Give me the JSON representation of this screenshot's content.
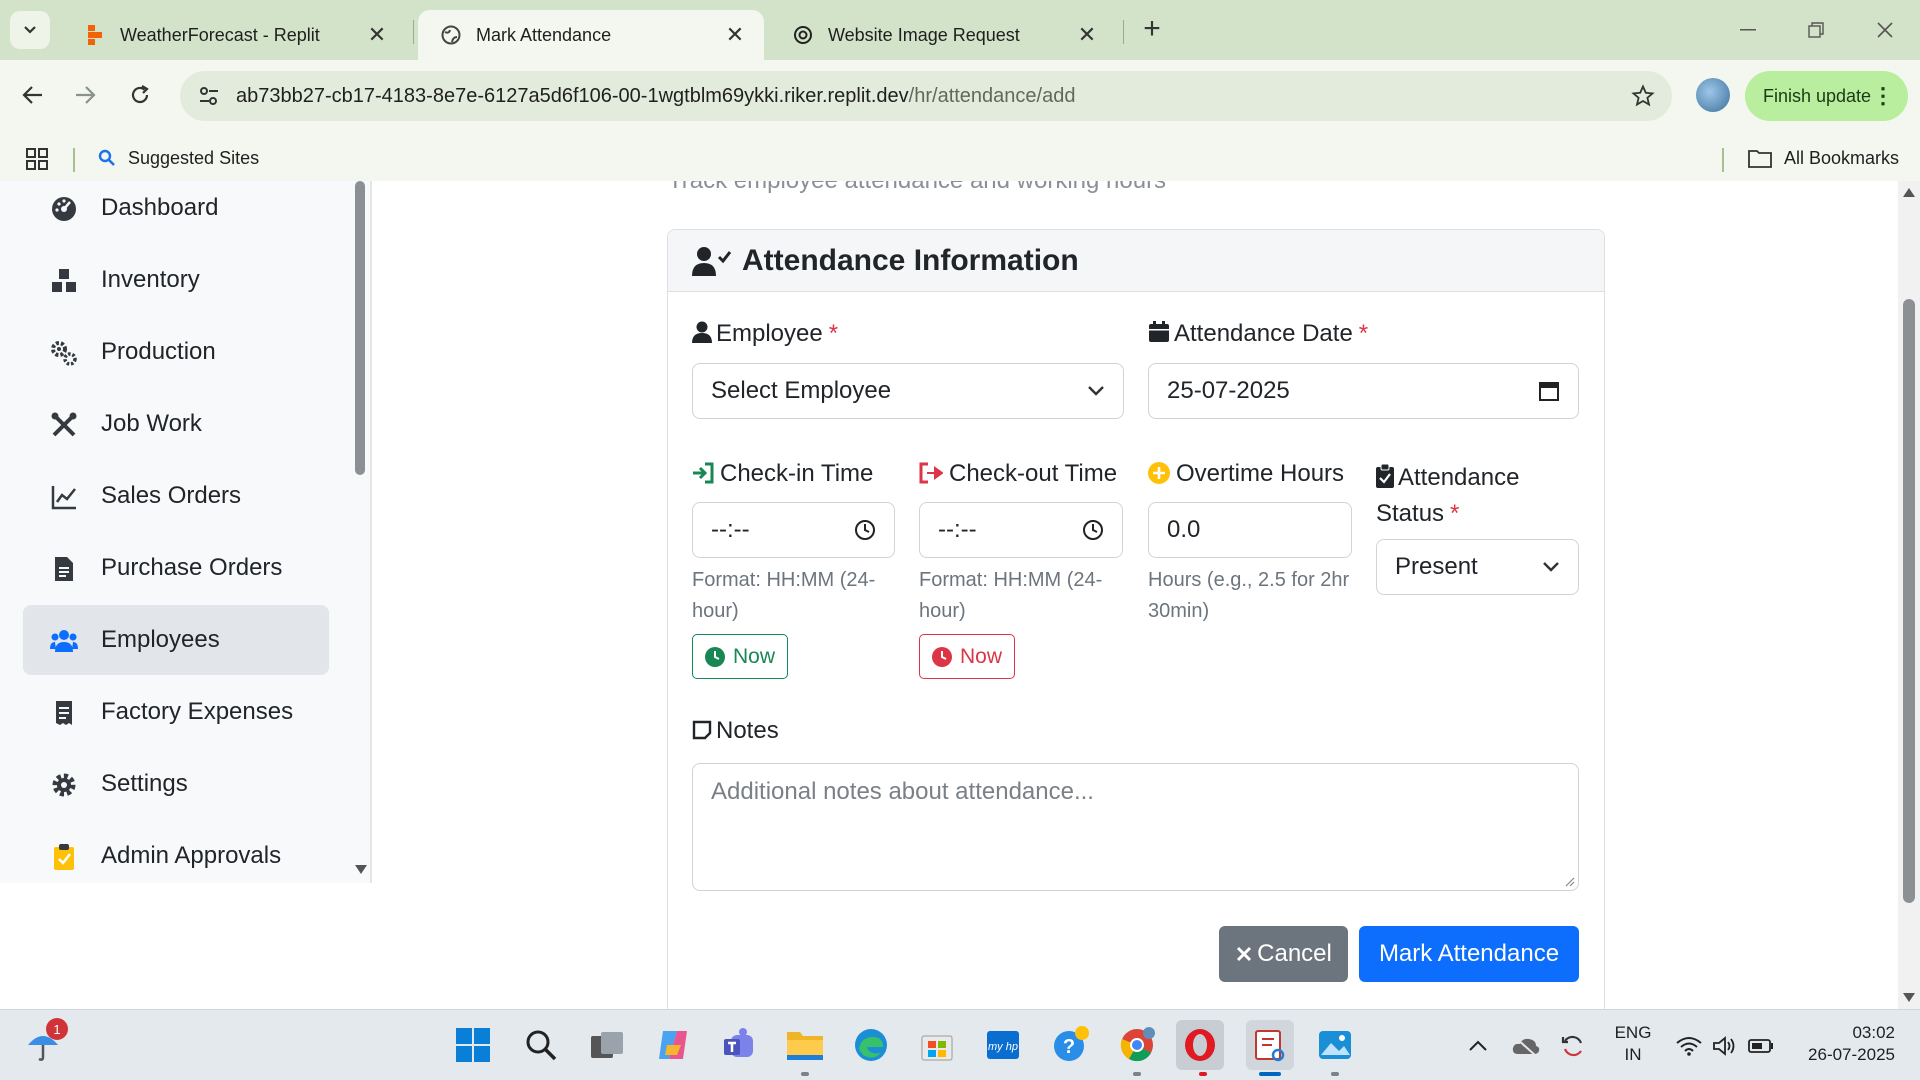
{
  "browser": {
    "tabs": [
      {
        "title": "WeatherForecast - Replit",
        "icon": "replit-icon"
      },
      {
        "title": "Mark Attendance",
        "icon": "globe-icon",
        "active": true
      },
      {
        "title": "Website Image Request",
        "icon": "openai-icon"
      }
    ],
    "url_host": "ab73bb27-cb17-4183-8e7e-6127a5d6f106-00-1wgtblm69ykki.riker.replit.dev",
    "url_path": "/hr/attendance/add",
    "finish_update": "Finish update",
    "bookmarks": {
      "suggested": "Suggested Sites",
      "all": "All Bookmarks"
    }
  },
  "sidebar": {
    "items": [
      {
        "label": "Dashboard",
        "icon": "dashboard-gauge-icon"
      },
      {
        "label": "Inventory",
        "icon": "boxes-icon"
      },
      {
        "label": "Production",
        "icon": "gears-icon"
      },
      {
        "label": "Job Work",
        "icon": "tools-icon"
      },
      {
        "label": "Sales Orders",
        "icon": "line-chart-icon"
      },
      {
        "label": "Purchase Orders",
        "icon": "document-icon"
      },
      {
        "label": "Employees",
        "icon": "users-icon",
        "active": true
      },
      {
        "label": "Factory Expenses",
        "icon": "receipt-icon"
      },
      {
        "label": "Settings",
        "icon": "gear-icon"
      },
      {
        "label": "Admin Approvals",
        "icon": "clipboard-check-icon"
      }
    ]
  },
  "page": {
    "subtitle": "Track employee attendance and working hours"
  },
  "form": {
    "header": "Attendance Information",
    "employee": {
      "label": "Employee",
      "required": "*",
      "value": "Select Employee"
    },
    "date": {
      "label": "Attendance Date",
      "required": "*",
      "value": "25-07-2025"
    },
    "checkin": {
      "label": "Check-in Time",
      "value": "--:--",
      "hint": "Format: HH:MM (24-hour)",
      "now": "Now"
    },
    "checkout": {
      "label": "Check-out Time",
      "value": "--:--",
      "hint": "Format: HH:MM (24-hour)",
      "now": "Now"
    },
    "overtime": {
      "label": "Overtime Hours",
      "value": "0.0",
      "hint": "Hours (e.g., 2.5 for 2hr 30min)"
    },
    "status": {
      "label": "Attendance Status",
      "required": "*",
      "value": "Present"
    },
    "notes": {
      "label": "Notes",
      "placeholder": "Additional notes about attendance..."
    },
    "cancel": "Cancel",
    "submit": "Mark Attendance"
  },
  "taskbar": {
    "notification_count": "1",
    "lang_line1": "ENG",
    "lang_line2": "IN",
    "time": "03:02",
    "date": "26-07-2025"
  },
  "colors": {
    "primary": "#0d6efd",
    "success": "#198754",
    "danger": "#dc3545",
    "secondary": "#6c757d"
  }
}
